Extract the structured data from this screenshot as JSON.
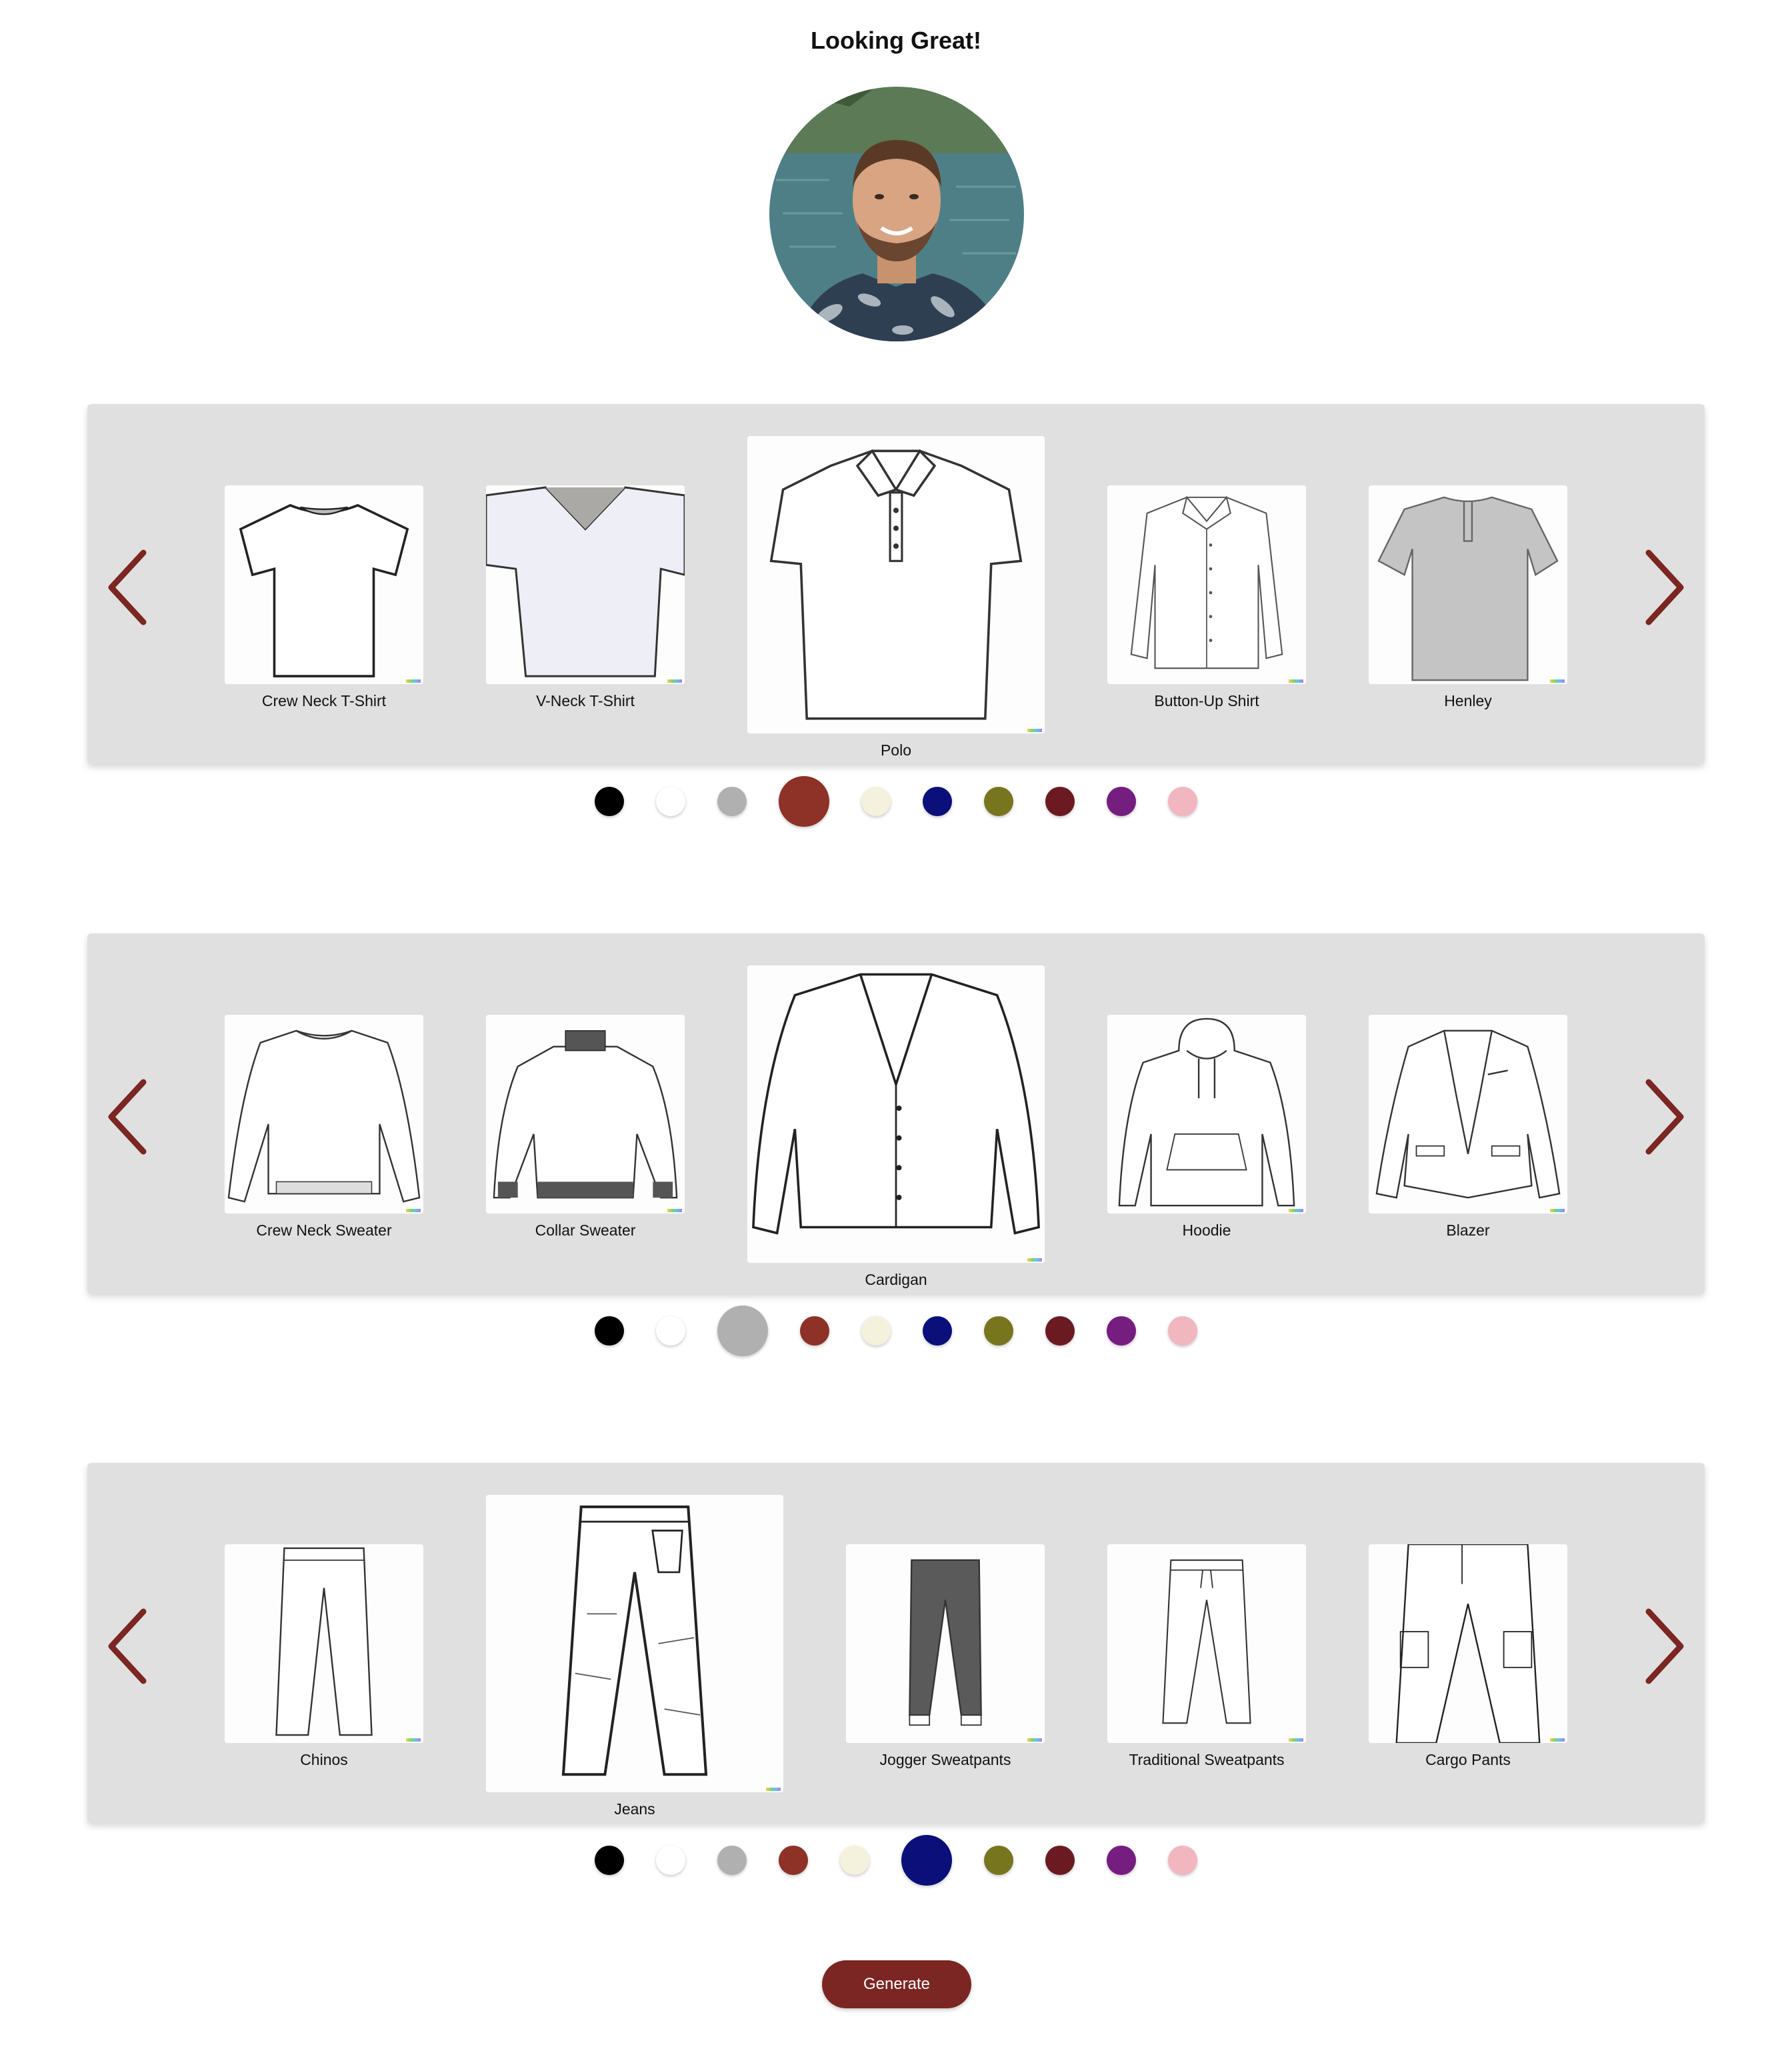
{
  "page": {
    "title": "Looking Great!"
  },
  "generate_label": "Generate",
  "accent": "#7b2622",
  "colors": [
    "#000000",
    "#ffffff",
    "#b0b0b0",
    "#8e3126",
    "#f4f1dd",
    "#0a0f7a",
    "#77761f",
    "#6b1a22",
    "#761d80",
    "#f2b6c0"
  ],
  "color_names": [
    "black",
    "white",
    "gray",
    "rust",
    "cream",
    "navy",
    "olive",
    "maroon",
    "purple",
    "pink"
  ],
  "tops": {
    "items": [
      "Crew Neck T-Shirt",
      "V-Neck T-Shirt",
      "Polo",
      "Button-Up Shirt",
      "Henley"
    ],
    "selected_item": "Polo",
    "selected_color": "rust"
  },
  "layers": {
    "items": [
      "Crew Neck Sweater",
      "Collar Sweater",
      "Cardigan",
      "Hoodie",
      "Blazer"
    ],
    "selected_item": "Cardigan",
    "selected_color": "gray"
  },
  "bottoms": {
    "items": [
      "Chinos",
      "Jeans",
      "Jogger Sweatpants",
      "Traditional Sweatpants",
      "Cargo Pants"
    ],
    "selected_item": "Jeans",
    "selected_color": "navy"
  }
}
